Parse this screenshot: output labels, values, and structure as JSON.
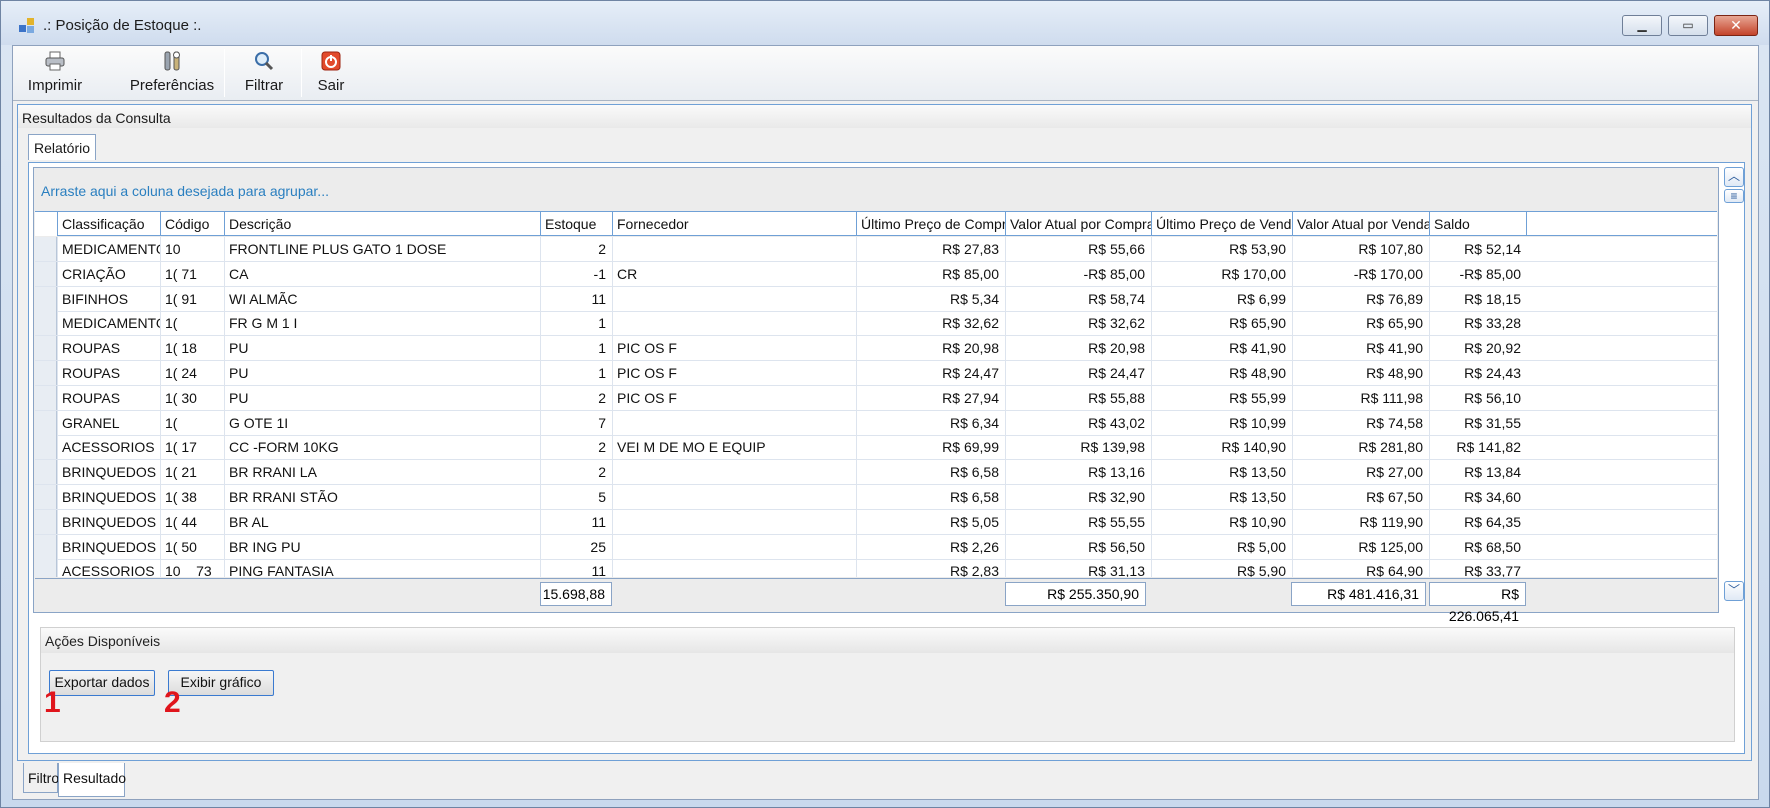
{
  "window": {
    "title": ".: Posição de Estoque :.",
    "minimize": "▁",
    "maximize": "▭",
    "close": "✕"
  },
  "toolbar": {
    "items": [
      {
        "label": "Imprimir",
        "icon": "printer-icon"
      },
      {
        "label": "Preferências",
        "icon": "tools-icon"
      },
      {
        "label": "Filtrar",
        "icon": "magnifier-icon"
      },
      {
        "label": "Sair",
        "icon": "power-icon"
      }
    ]
  },
  "group_title": "Resultados da Consulta",
  "inner_tab": "Relatório",
  "grid": {
    "group_hint": "Arraste aqui a coluna desejada para agrupar...",
    "columns": [
      "Classificação",
      "Código",
      "Descrição",
      "Estoque",
      "Fornecedor",
      "Último Preço de Compra",
      "Valor Atual por Compra",
      "Último Preço de Venda",
      "Valor Atual por Venda",
      "Saldo"
    ],
    "rows": [
      [
        "MEDICAMENTOS",
        "10",
        "FRONTLINE PLUS GATO 1 DOSE",
        "2",
        "",
        "R$ 27,83",
        "R$ 55,66",
        "R$ 53,90",
        "R$ 107,80",
        "R$ 52,14"
      ],
      [
        "CRIAÇÃO",
        "1(     71",
        "CA",
        "-1",
        "CR",
        "R$ 85,00",
        "-R$ 85,00",
        "R$ 170,00",
        "-R$ 170,00",
        "-R$ 85,00"
      ],
      [
        "BIFINHOS",
        "1(     91",
        "WI                                   ALMÃC",
        "11",
        "",
        "R$ 5,34",
        "R$ 58,74",
        "R$ 6,99",
        "R$ 76,89",
        "R$ 18,15"
      ],
      [
        "MEDICAMENTOS",
        "1(",
        "FR                                   G M 1 I",
        "1",
        "",
        "R$ 32,62",
        "R$ 32,62",
        "R$ 65,90",
        "R$ 65,90",
        "R$ 33,28"
      ],
      [
        "ROUPAS",
        "1(     18",
        "PU",
        "1",
        "PIC               OS F",
        "R$ 20,98",
        "R$ 20,98",
        "R$ 41,90",
        "R$ 41,90",
        "R$ 20,92"
      ],
      [
        "ROUPAS",
        "1(     24",
        "PU",
        "1",
        "PIC               OS F",
        "R$ 24,47",
        "R$ 24,47",
        "R$ 48,90",
        "R$ 48,90",
        "R$ 24,43"
      ],
      [
        "ROUPAS",
        "1(     30",
        "PU",
        "2",
        "PIC               OS F",
        "R$ 27,94",
        "R$ 55,88",
        "R$ 55,99",
        "R$ 111,98",
        "R$ 56,10"
      ],
      [
        "GRANEL",
        "1(",
        "G                                    OTE 1I",
        "7",
        "",
        "R$ 6,34",
        "R$ 43,02",
        "R$ 10,99",
        "R$ 74,58",
        "R$ 31,55"
      ],
      [
        "ACESSORIOS",
        "1(     17",
        "CC                                  -FORM              10KG",
        "2",
        "VEI              M DE               MO E EQUIP",
        "R$ 69,99",
        "R$ 139,98",
        "R$ 140,90",
        "R$ 281,80",
        "R$ 141,82"
      ],
      [
        "BRINQUEDOS",
        "1(     21",
        "BR                                   RRANI             LA",
        "2",
        "",
        "R$ 6,58",
        "R$ 13,16",
        "R$ 13,50",
        "R$ 27,00",
        "R$ 13,84"
      ],
      [
        "BRINQUEDOS",
        "1(     38",
        "BR                                   RRANI             STÃO",
        "5",
        "",
        "R$ 6,58",
        "R$ 32,90",
        "R$ 13,50",
        "R$ 67,50",
        "R$ 34,60"
      ],
      [
        "BRINQUEDOS",
        "1(     44",
        "BR                                   AL",
        "11",
        "",
        "R$ 5,05",
        "R$ 55,55",
        "R$ 10,90",
        "R$ 119,90",
        "R$ 64,35"
      ],
      [
        "BRINQUEDOS",
        "1(     50",
        "BR                                   ING PU",
        "25",
        "",
        "R$ 2,26",
        "R$ 56,50",
        "R$ 5,00",
        "R$ 125,00",
        "R$ 68,50"
      ],
      [
        "ACESSORIOS",
        "10__73",
        "PING FANTASIA",
        "11",
        "",
        "R$ 2,83",
        "R$ 31,13",
        "R$ 5,90",
        "R$ 64,90",
        "R$ 33,77"
      ]
    ],
    "totals": {
      "estoque": "15.698,88",
      "valor_compra": "R$ 255.350,90",
      "valor_venda": "R$ 481.416,31",
      "saldo": "R$ 226.065,41"
    },
    "scroll_up": "︿",
    "scroll_menu": "≡",
    "scroll_down": "﹀"
  },
  "actions": {
    "title": "Ações Disponíveis",
    "export_label": "Exportar dados",
    "chart_label": "Exibir gráfico",
    "marker_1": "1",
    "marker_2": "2"
  },
  "bottom_tabs": [
    "Filtro",
    "Resultado"
  ],
  "colors": {
    "accent": "#2a7fc0",
    "marker": "#e0151c",
    "border": "#6fa0d6"
  }
}
